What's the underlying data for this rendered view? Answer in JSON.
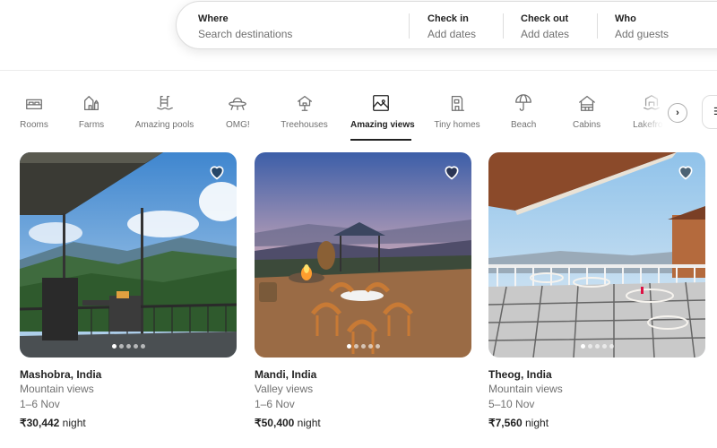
{
  "search": {
    "where_label": "Where",
    "where_placeholder": "Search destinations",
    "checkin_label": "Check in",
    "checkin_value": "Add dates",
    "checkout_label": "Check out",
    "checkout_value": "Add dates",
    "who_label": "Who",
    "who_value": "Add guests"
  },
  "categories": [
    {
      "label": "Rooms",
      "icon": "rooms-icon"
    },
    {
      "label": "Farms",
      "icon": "farms-icon"
    },
    {
      "label": "Amazing pools",
      "icon": "pool-icon"
    },
    {
      "label": "OMG!",
      "icon": "ufo-icon"
    },
    {
      "label": "Treehouses",
      "icon": "treehouse-icon"
    },
    {
      "label": "Amazing views",
      "icon": "views-icon",
      "active": true
    },
    {
      "label": "Tiny homes",
      "icon": "tiny-home-icon"
    },
    {
      "label": "Beach",
      "icon": "beach-umbrella-icon"
    },
    {
      "label": "Cabins",
      "icon": "cabin-icon"
    },
    {
      "label": "Lakefront",
      "icon": "lakefront-icon"
    }
  ],
  "nav": {
    "next_icon": "chevron-right-icon",
    "next_glyph": "›",
    "filter_glyph": "☰"
  },
  "listings": [
    {
      "title": "Mashobra, India",
      "subtitle": "Mountain views",
      "dates": "1–6 Nov",
      "price": "₹30,442",
      "price_unit": " night",
      "photos": 5,
      "current_photo": 1
    },
    {
      "title": "Mandi, India",
      "subtitle": "Valley views",
      "dates": "1–6 Nov",
      "price": "₹50,400",
      "price_unit": " night",
      "photos": 5,
      "current_photo": 1
    },
    {
      "title": "Theog, India",
      "subtitle": "Mountain views",
      "dates": "5–10 Nov",
      "price": "₹7,560",
      "price_unit": " night",
      "photos": 5,
      "current_photo": 1
    }
  ],
  "colors": {
    "text_primary": "#222222",
    "text_secondary": "#717171",
    "border": "#dddddd"
  }
}
